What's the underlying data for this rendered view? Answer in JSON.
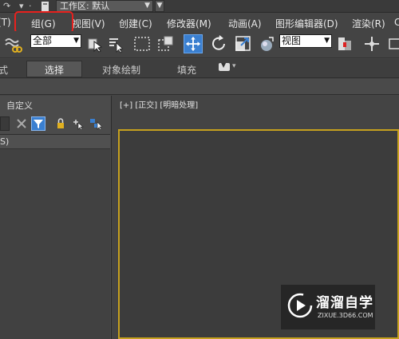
{
  "titlebar": {
    "workspace_label": "工作区: 默认"
  },
  "menubar": {
    "items": [
      "(T)",
      "组(G)",
      "视图(V)",
      "创建(C)",
      "修改器(M)",
      "动画(A)",
      "图形编辑器(D)",
      "渲染(R)",
      "C"
    ]
  },
  "toolbar": {
    "selection_filter": "全部",
    "reference_coord": "视图"
  },
  "ribbon": {
    "tabs": [
      "式",
      "选择",
      "对象绘制",
      "填充"
    ]
  },
  "scene_explorer": {
    "title": "自定义",
    "list_header": "S)"
  },
  "viewport": {
    "label_plus": "[+]",
    "label_view": "[正交]",
    "label_shading": "[明暗处理]"
  },
  "watermark": {
    "title": "溜溜自学",
    "url": "ZIXUE.3D66.COM"
  },
  "colors": {
    "highlight_border": "#e8201d",
    "active_viewport_border": "#c6a11e",
    "ui_background": "#444444"
  }
}
